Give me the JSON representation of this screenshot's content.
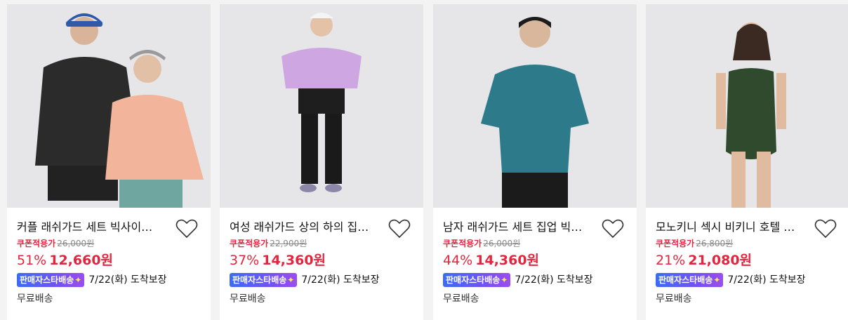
{
  "products": [
    {
      "title": "커플 래쉬가드 세트 빅사이…",
      "coupon_label": "쿠폰적용가",
      "original_price": "26,000원",
      "discount": "51%",
      "price": "12,660원",
      "badge": "판매자스타배송",
      "delivery": "7/22(화) 도착보장",
      "shipping": "무료배송",
      "image": "couple-rashguard-photo"
    },
    {
      "title": "여성 래쉬가드 상의 하의 집…",
      "coupon_label": "쿠폰적용가",
      "original_price": "22,900원",
      "discount": "37%",
      "price": "14,360원",
      "badge": "판매자스타배송",
      "delivery": "7/22(화) 도착보장",
      "shipping": "무료배송",
      "image": "women-rashguard-photo"
    },
    {
      "title": "남자 래쉬가드 세트 집업 빅…",
      "coupon_label": "쿠폰적용가",
      "original_price": "26,000원",
      "discount": "44%",
      "price": "14,360원",
      "badge": "판매자스타배송",
      "delivery": "7/22(화) 도착보장",
      "shipping": "무료배송",
      "image": "men-rashguard-photo"
    },
    {
      "title": "모노키니 섹시 비키니 호텔 …",
      "coupon_label": "쿠폰적용가",
      "original_price": "26,800원",
      "discount": "21%",
      "price": "21,080원",
      "badge": "판매자스타배송",
      "delivery": "7/22(화) 도착보장",
      "shipping": "무료배송",
      "image": "monokini-photo"
    }
  ],
  "icons": {
    "wishlist": "heart-outline-icon",
    "badge_spark": "sparkle-icon"
  },
  "colors": {
    "accent_red": "#e4253d",
    "badge_blue": "#3b6cf6",
    "badge_purple": "#9b4ef0"
  }
}
